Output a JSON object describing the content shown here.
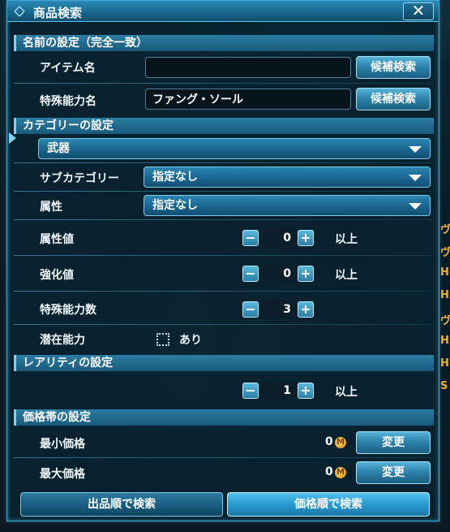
{
  "window": {
    "title": "商品検索",
    "close_label": "✕"
  },
  "name_section": {
    "header": "名前の設定（完全一致）",
    "item_name_label": "アイテム名",
    "item_name_value": "",
    "item_candidate_button": "候補検索",
    "ability_name_label": "特殊能力名",
    "ability_name_value": "ファング・ソール",
    "ability_candidate_button": "候補検索"
  },
  "category_section": {
    "header": "カテゴリーの設定",
    "category_value": "武器",
    "subcategory_label": "サブカテゴリー",
    "subcategory_value": "指定なし",
    "element_label": "属性",
    "element_value": "指定なし",
    "element_value_label": "属性値",
    "element_value_amount": "0",
    "element_value_suffix": "以上",
    "grind_label": "強化値",
    "grind_amount": "0",
    "grind_suffix": "以上",
    "ability_count_label": "特殊能力数",
    "ability_count_amount": "3",
    "latent_label": "潜在能力",
    "latent_option": "あり",
    "latent_checked": false
  },
  "rarity_section": {
    "header": "レアリティの設定",
    "rarity_amount": "1",
    "rarity_suffix": "以上"
  },
  "price_section": {
    "header": "価格帯の設定",
    "min_label": "最小価格",
    "min_value": "0",
    "min_change_button": "変更",
    "max_label": "最大価格",
    "max_value": "0",
    "max_change_button": "変更"
  },
  "footer": {
    "search_by_listing": "出品順で検索",
    "search_by_price": "価格順で検索"
  },
  "icons": {
    "minus": "−",
    "plus": "+",
    "meseta": "M"
  },
  "colors": {
    "accent": "#3fa9d3",
    "panel": "#082230",
    "button": "#2d83ad"
  }
}
